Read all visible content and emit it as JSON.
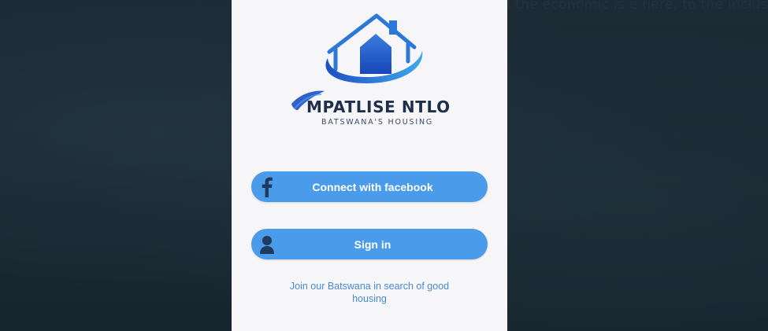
{
  "background": {
    "partial_text": "...and the economic is e here, to the inclus"
  },
  "app": {
    "brand_name": "MPATLISE NTLO",
    "tagline": "BATSWANA'S HOUSING",
    "logo_icon": "house-swoosh-logo"
  },
  "buttons": {
    "facebook_label": "Connect with facebook",
    "facebook_icon": "facebook-icon",
    "signin_label": "Sign in",
    "signin_icon": "user-icon"
  },
  "join_text": "Join our Batswana in search of good housing",
  "colors": {
    "button": "#4a9bea",
    "brand_dark": "#1f2f4a",
    "accent": "#2f6bd9",
    "join_text": "#4a8ad4",
    "backdrop": "#1a2a34"
  }
}
